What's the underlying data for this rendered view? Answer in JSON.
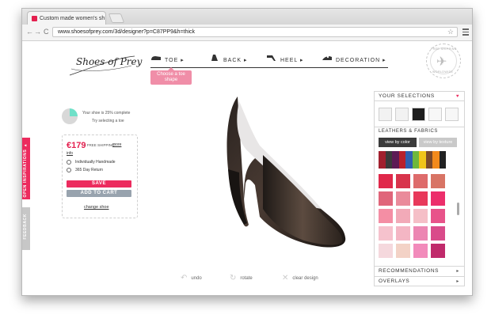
{
  "browser": {
    "tab_title": "Custom made women's sh",
    "tab_close": "×",
    "url": "www.shoesofprey.com/3d/designer?p=C87PP9&h=thick",
    "nav_back": "←",
    "nav_forward": "→",
    "nav_reload": "C",
    "star": "☆"
  },
  "header": {
    "logo_text": "Shoes of Prey",
    "steps": [
      {
        "label": "TOE",
        "arrow": "▸",
        "icon": "toe-icon"
      },
      {
        "label": "BACK",
        "arrow": "▸",
        "icon": "back-icon"
      },
      {
        "label": "HEEL",
        "arrow": "▸",
        "icon": "heel-icon"
      },
      {
        "label": "DECORATION",
        "arrow": "▸",
        "icon": "decoration-icon"
      }
    ],
    "tooltip": "Choose a toe shape",
    "badge_top": "FREE SHIPPING",
    "badge_bottom": "WORLDWIDE"
  },
  "progress": {
    "percent": 25,
    "text": "Your shoe is 25% complete",
    "sub": "Try selecting a toe"
  },
  "purchase": {
    "price": "€179",
    "shipping": "– FREE SHIPPING",
    "more_label": "more",
    "info_label": "info",
    "feature_1": "Individually Handmade",
    "feature_2": "365 Day Return",
    "save_label": "SAVE",
    "cart_label": "ADD TO CART",
    "change_label": "change shoe"
  },
  "side_tabs": {
    "inspirations": "OPEN INSPIRATIONS ▸",
    "feedback": "FEEDBACK"
  },
  "controls": {
    "undo": "undo",
    "rotate": "rotate",
    "clear": "clear design"
  },
  "panel": {
    "title": "YOUR SELECTIONS",
    "heart": "♥",
    "selections": [
      "#f2f2f2",
      "#f2f2f2",
      "#1e1e1e",
      "#f7f7f7",
      "#f7f7f7"
    ],
    "leathers_title": "LEATHERS & FABRICS",
    "view_color": "view by color",
    "view_texture": "view by texture",
    "color_strip": [
      "#a1202e",
      "#3a3a3a",
      "#5c1a55",
      "#b8202c",
      "#2f5fb0",
      "#6eb83d",
      "#f0c419",
      "#7a4a2a",
      "#f28a1c",
      "#222222",
      "#ffffff"
    ],
    "swatches": [
      "#e0284a",
      "#d8344c",
      "#de6b6b",
      "#d87465",
      "#e0657a",
      "#ea8b9b",
      "#e8395a",
      "#ec2e6b",
      "#f48ea4",
      "#f2aab8",
      "#f5bfc7",
      "#e8538a",
      "#f6c2cd",
      "#f4b6c4",
      "#ec86b2",
      "#d94b8a",
      "#f5d8dd",
      "#f3d2c6",
      "#f28bbb",
      "#c02a6b"
    ],
    "recommendations": "RECOMMENDATIONS",
    "overlays": "OVERLAYS",
    "foot_arrow": "▸"
  }
}
